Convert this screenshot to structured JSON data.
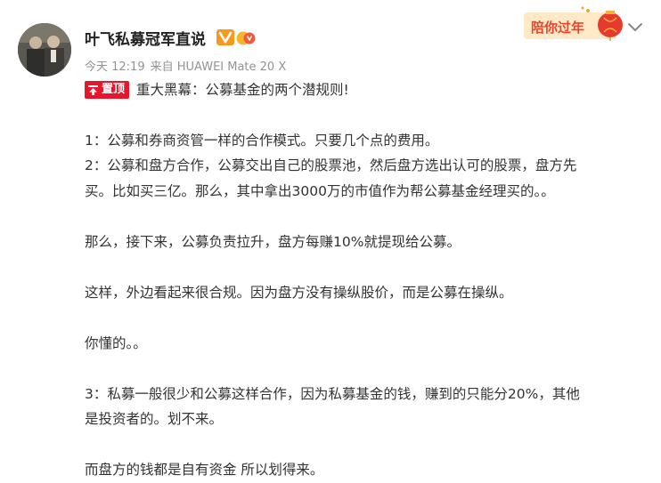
{
  "post": {
    "author_name": "叶飞私募冠军直说",
    "time": "今天 12:19",
    "source": "来自 HUAWEI Mate 20 X",
    "pin_label": "置顶",
    "title": "重大黑幕：公募基金的两个潜规则!",
    "paragraphs": [
      "1：公募和券商资管一样的合作模式。只要几个点的费用。",
      "2：公募和盘方合作，公募交出自己的股票池，然后盘方选出认可的股票，盘方先",
      "买。比如买三亿。那么，其中拿出3000万的市值作为帮公募基金经理买的。。",
      "那么，接下来，公募负责拉升，盘方每赚10%就提现给公募。",
      "这样，外边看起来很合规。因为盘方没有操纵股价，而是公募在操纵。",
      "你懂的。。",
      "3：私募一般很少和公募这样合作，因为私募基金的钱，赚到的只能分20%，其他",
      "是投资者的。划不来。",
      "而盘方的钱都是自有资金 所以划得来。"
    ]
  },
  "promo": {
    "text": "陪你过年"
  },
  "icons": {
    "avatar": "avatar-photo",
    "verified": "verified-v-icon",
    "level": "level-badge-icon",
    "pin": "pin-top-icon",
    "chevron": "chevron-down-icon"
  },
  "colors": {
    "pin_red": "#e6162d",
    "verified_orange": "#f69a1f",
    "meta_gray": "#939393",
    "promo_red": "#e8452c"
  }
}
